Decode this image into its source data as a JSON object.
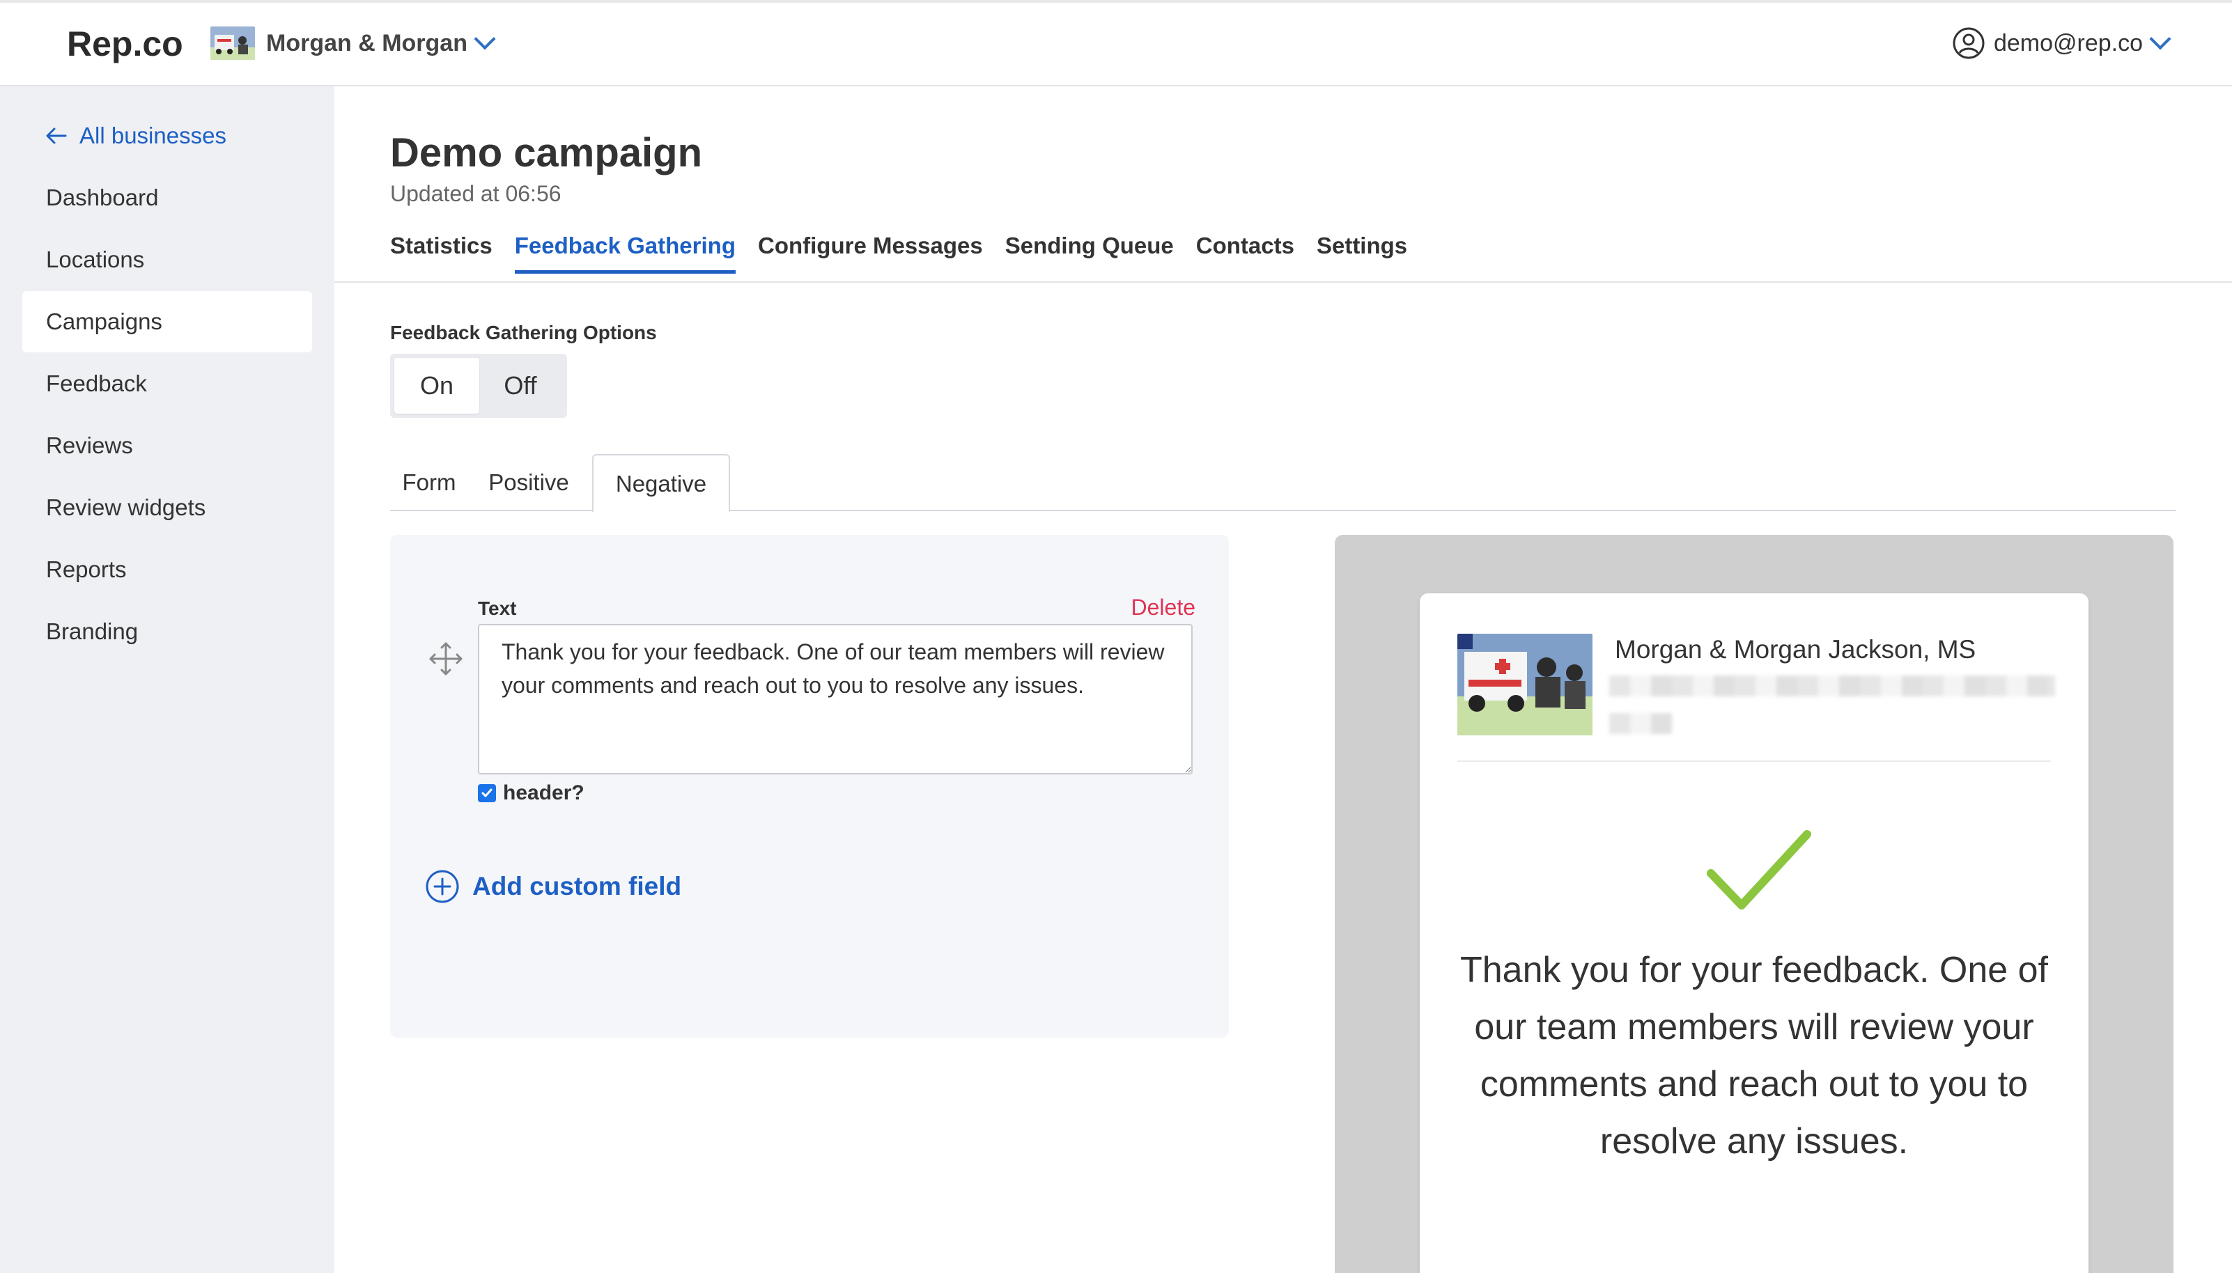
{
  "app": {
    "brand": "Rep.co"
  },
  "business_switcher": {
    "name": "Morgan & Morgan"
  },
  "user": {
    "email": "demo@rep.co"
  },
  "sidebar": {
    "back_label": "All businesses",
    "items": [
      {
        "label": "Dashboard",
        "active": false
      },
      {
        "label": "Locations",
        "active": false
      },
      {
        "label": "Campaigns",
        "active": true
      },
      {
        "label": "Feedback",
        "active": false
      },
      {
        "label": "Reviews",
        "active": false
      },
      {
        "label": "Review widgets",
        "active": false
      },
      {
        "label": "Reports",
        "active": false
      },
      {
        "label": "Branding",
        "active": false
      }
    ]
  },
  "page": {
    "title": "Demo campaign",
    "updated": "Updated at 06:56"
  },
  "tabs": [
    {
      "label": "Statistics",
      "active": false
    },
    {
      "label": "Feedback Gathering",
      "active": true
    },
    {
      "label": "Configure Messages",
      "active": false
    },
    {
      "label": "Sending Queue",
      "active": false
    },
    {
      "label": "Contacts",
      "active": false
    },
    {
      "label": "Settings",
      "active": false
    }
  ],
  "feedback_options": {
    "label": "Feedback Gathering Options",
    "on_label": "On",
    "off_label": "Off",
    "selected": "On"
  },
  "subtabs": [
    {
      "label": "Form",
      "active": false
    },
    {
      "label": "Positive",
      "active": false
    },
    {
      "label": "Negative",
      "active": true
    }
  ],
  "editor": {
    "field_label": "Text",
    "delete_label": "Delete",
    "text_value": "Thank you for your feedback. One of our team members will review your comments and reach out to you to resolve any issues.",
    "header_checkbox_label": "header?",
    "header_checked": true,
    "add_field_label": "Add custom field"
  },
  "preview": {
    "business_name": "Morgan & Morgan Jackson, MS",
    "message": "Thank you for your feedback. One of our team members will review your comments and reach out to you to resolve any issues.",
    "check_color": "#8cc63f"
  },
  "colors": {
    "accent": "#1d5fc4",
    "delete": "#e03352",
    "sidebar_bg": "#eef0f4"
  }
}
